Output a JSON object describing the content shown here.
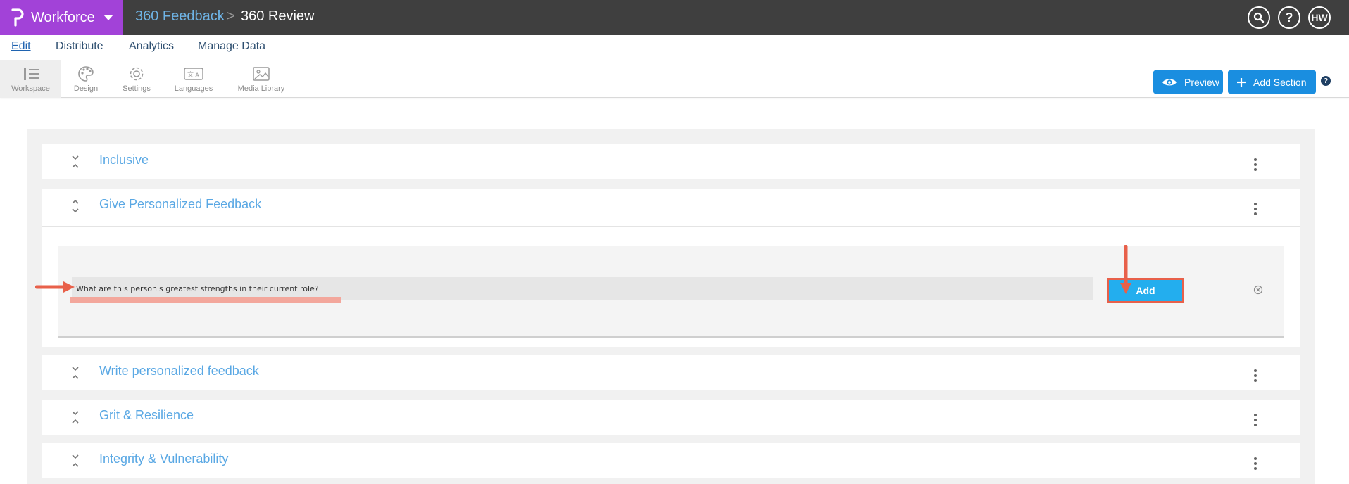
{
  "header": {
    "app_name": "Workforce",
    "breadcrumb": [
      "360 Feedback",
      "360 Review"
    ],
    "breadcrumb_sep": ">",
    "search_icon": "search-icon",
    "help_label": "?",
    "avatar_initials": "HW",
    "brand_color": "#a242d8",
    "bar_color": "#3f3f3f"
  },
  "menu": {
    "items": [
      "Edit",
      "Distribute",
      "Analytics",
      "Manage Data"
    ],
    "active": "Edit"
  },
  "toolbar": {
    "tools": [
      {
        "label": "Workspace",
        "icon": "workspace-icon"
      },
      {
        "label": "Design",
        "icon": "palette-icon"
      },
      {
        "label": "Settings",
        "icon": "gear-icon"
      },
      {
        "label": "Languages",
        "icon": "translate-icon"
      },
      {
        "label": "Media Library",
        "icon": "image-icon"
      }
    ],
    "preview_label": "Preview",
    "add_section_label": "Add Section",
    "help_label": "?",
    "accent_color": "#1a8ee0"
  },
  "sections": [
    {
      "title": "Inclusive",
      "expanded": false
    },
    {
      "title": "Give Personalized Feedback",
      "expanded": true
    },
    {
      "title": "Write personalized feedback",
      "expanded": false
    },
    {
      "title": "Grit & Resilience",
      "expanded": false
    },
    {
      "title": "Integrity & Vulnerability",
      "expanded": false
    }
  ],
  "editor": {
    "question_value": "What are this person's greatest strengths in their current role?",
    "add_label": "Add",
    "add_color": "#23aeee",
    "highlight_color": "#e8604a"
  }
}
